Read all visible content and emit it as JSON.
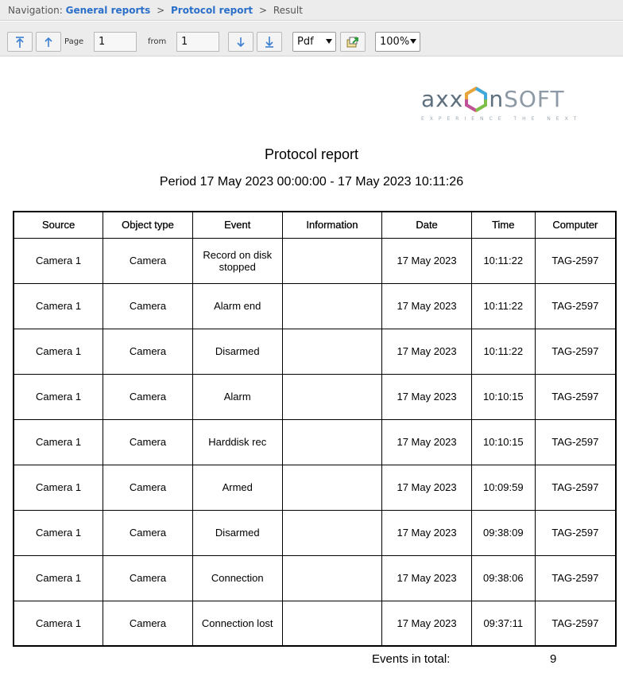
{
  "navigation": {
    "label": "Navigation:",
    "crumbs": [
      "General reports",
      "Protocol report"
    ],
    "current": "Result",
    "separator": ">"
  },
  "toolbar": {
    "page_label": "Page",
    "page_value": "1",
    "from_label": "from",
    "from_value": "1",
    "format_selected": "Pdf",
    "zoom_selected": "100%"
  },
  "logo": {
    "name": "AXXONSOFT",
    "tagline": "EXPERIENCE THE NEXT"
  },
  "report": {
    "title": "Protocol report",
    "period": "Period 17 May 2023 00:00:00 - 17 May 2023 10:11:26",
    "columns": [
      "Source",
      "Object type",
      "Event",
      "Information",
      "Date",
      "Time",
      "Computer"
    ],
    "rows": [
      [
        "Camera 1",
        "Camera",
        "Record on disk stopped",
        "",
        "17 May 2023",
        "10:11:22",
        "TAG-2597"
      ],
      [
        "Camera 1",
        "Camera",
        "Alarm end",
        "",
        "17 May 2023",
        "10:11:22",
        "TAG-2597"
      ],
      [
        "Camera 1",
        "Camera",
        "Disarmed",
        "",
        "17 May 2023",
        "10:11:22",
        "TAG-2597"
      ],
      [
        "Camera 1",
        "Camera",
        "Alarm",
        "",
        "17 May 2023",
        "10:10:15",
        "TAG-2597"
      ],
      [
        "Camera 1",
        "Camera",
        "Harddisk rec",
        "",
        "17 May 2023",
        "10:10:15",
        "TAG-2597"
      ],
      [
        "Camera 1",
        "Camera",
        "Armed",
        "",
        "17 May 2023",
        "10:09:59",
        "TAG-2597"
      ],
      [
        "Camera 1",
        "Camera",
        "Disarmed",
        "",
        "17 May 2023",
        "09:38:09",
        "TAG-2597"
      ],
      [
        "Camera 1",
        "Camera",
        "Connection",
        "",
        "17 May 2023",
        "09:38:06",
        "TAG-2597"
      ],
      [
        "Camera 1",
        "Camera",
        "Connection lost",
        "",
        "17 May 2023",
        "09:37:11",
        "TAG-2597"
      ]
    ],
    "total_label": "Events in total:",
    "total_value": "9"
  },
  "colors": {
    "link": "#2a6fc9",
    "toolbar_bg": "#ececec",
    "icon_blue": "#3a7fd0"
  },
  "icons": [
    "first-page-icon",
    "previous-page-icon",
    "next-page-icon",
    "last-page-icon",
    "export-icon"
  ]
}
